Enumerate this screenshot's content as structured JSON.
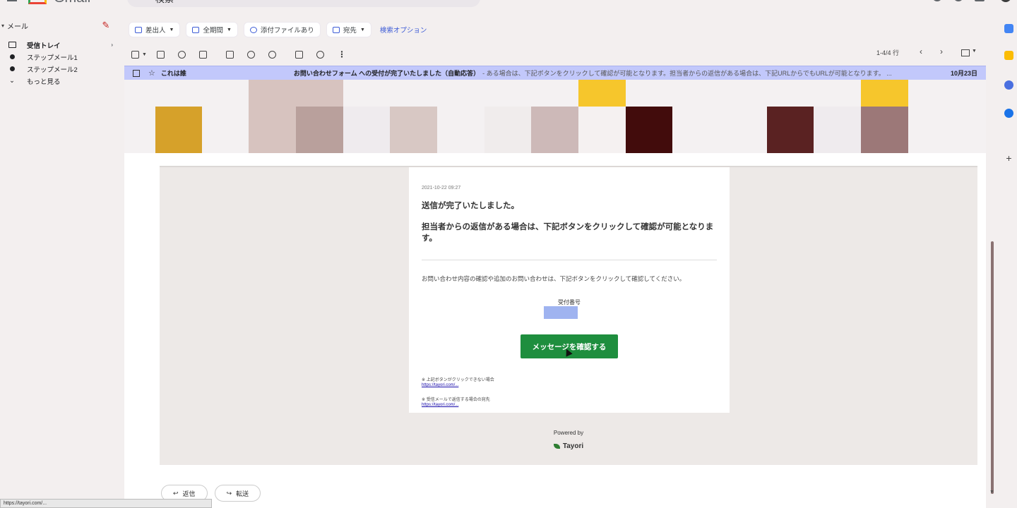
{
  "app": {
    "name": "Gmail",
    "search_query": "検索"
  },
  "nav": {
    "section_label": "メール",
    "items": [
      {
        "label": "受信トレイ",
        "icon": "inbox-icon",
        "active": true
      },
      {
        "label": "ステップメール1",
        "icon": "label-icon"
      },
      {
        "label": "ステップメール2",
        "icon": "label-icon"
      },
      {
        "label": "もっと見る",
        "icon": "chevron-down-icon"
      }
    ]
  },
  "filters": {
    "chips": [
      {
        "label": "差出人"
      },
      {
        "label": "全期間"
      },
      {
        "label": "添付ファイルあり"
      },
      {
        "label": "宛先"
      }
    ],
    "advanced_link": "検索オプション"
  },
  "toolbar": {
    "pager_text": "1-4/4 行"
  },
  "selected_mail": {
    "sender": "これは誰",
    "subject": "お問い合わせフォーム への受付が完了いたしました（自動応答）",
    "snippet": "- ある場合は、下記ボタンをクリックして確認が可能となります。担当者からの返信がある場合は、下記URLからでもURLが可能となります。 ...",
    "date": "10月23日"
  },
  "email_body": {
    "timestamp": "2021-10-22 09:27",
    "line1": "送信が完了いたしました。",
    "line2": "担当者からの返信がある場合は、下記ボタンをクリックして確認が可能となります。",
    "line3": "お問い合わせ内容の確認や追加のお問い合わせは、下記ボタンをクリックして確認してください。",
    "ticket_label": "受付番号",
    "cta_label": "メッセージを確認する",
    "note1": "※ 上記ボタンがクリックできない場合",
    "note2": "※ 受信メールで返信する場合の宛先",
    "powered_by": "Powered by",
    "brand": "Tayori"
  },
  "actions": {
    "reply": "返信",
    "forward": "転送"
  },
  "status_bar": {
    "url": "https://tayori.com/..."
  },
  "colors": {
    "row_highlight": "#c2c8fb",
    "cta": "#1e8e3e",
    "ticket_box": "#9fb3f0"
  }
}
